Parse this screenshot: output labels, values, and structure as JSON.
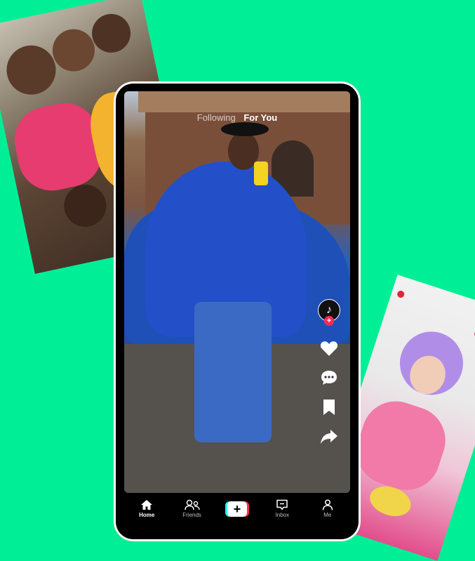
{
  "feed_tabs": {
    "following": "Following",
    "for_you": "For You"
  },
  "rail": {
    "avatar_glyph": "♪",
    "follow_glyph": "+"
  },
  "bottom_nav": {
    "home": "Home",
    "friends": "Friends",
    "create_glyph": "+",
    "inbox": "Inbox",
    "me": "Me"
  },
  "colors": {
    "background": "#00ef96",
    "accent_red": "#fe2c55",
    "accent_cyan": "#25f4ee"
  }
}
